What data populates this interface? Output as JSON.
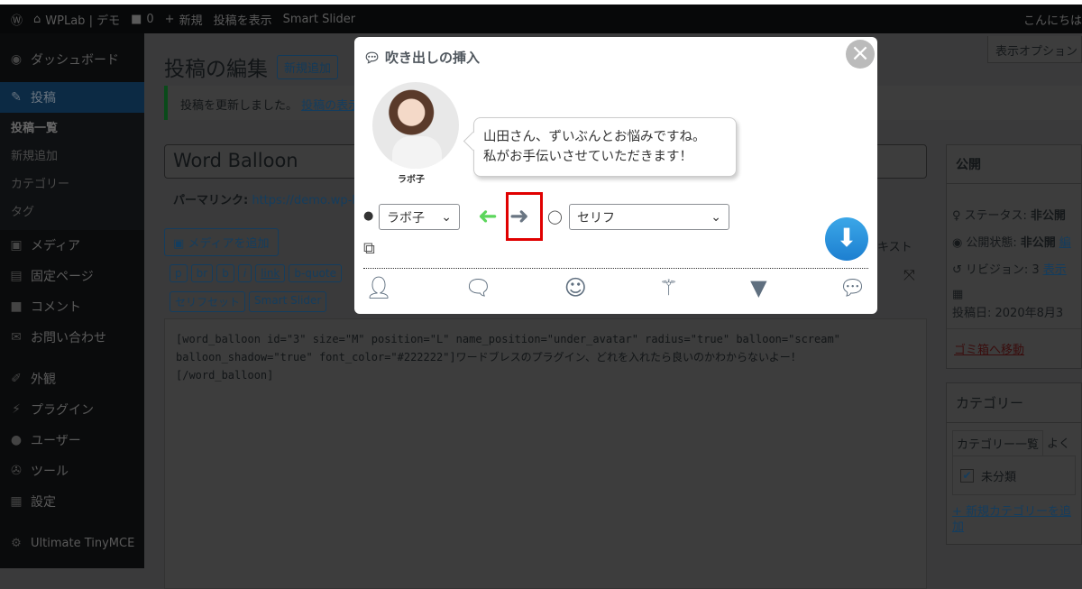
{
  "adminbar": {
    "site": "WPLab | デモ",
    "comments": "0",
    "new": "新規",
    "view": "投稿を表示",
    "slider": "Smart Slider",
    "greeting": "こんにちは"
  },
  "sidebar": {
    "dashboard": "ダッシュボード",
    "posts": "投稿",
    "sub": [
      "投稿一覧",
      "新規追加",
      "カテゴリー",
      "タグ"
    ],
    "items": [
      "メディア",
      "固定ページ",
      "コメント",
      "お問い合わせ",
      "外観",
      "プラグイン",
      "ユーザー",
      "ツール",
      "設定",
      "Ultimate TinyMCE"
    ]
  },
  "main": {
    "screen_options": "表示オプション",
    "page_title": "投稿の編集",
    "add_new": "新規追加",
    "notice": "投稿を更新しました。",
    "notice_link": "投稿の表示",
    "post_title": "Word Balloon",
    "permalink_label": "パーマリンク:",
    "permalink": "https://demo.wp-lab",
    "add_media": "メディアを追加",
    "tab_text": "テキスト",
    "quicktags": [
      "p",
      "br",
      "b",
      "i",
      "link",
      "b-quote"
    ],
    "quicktags2": [
      "セリフセット",
      "Smart Slider"
    ],
    "content": "[word_balloon id=\"3\" size=\"M\" position=\"L\" name_position=\"under_avatar\" radius=\"true\" balloon=\"scream\"\nballoon_shadow=\"true\" font_color=\"#222222\"]ワードブレスのプラグイン、どれを入れたら良いのかわからないよー！\n[/word_balloon]"
  },
  "publish": {
    "title": "公開",
    "status": "ステータス: ",
    "status_v": "非公開",
    "visibility": "公開状態: ",
    "visibility_v": "非公開",
    "visibility_link": "編",
    "revision": "リビジョン: 3",
    "revision_link": "表示",
    "date": "投稿日: 2020年8月3",
    "trash": "ゴミ箱へ移動"
  },
  "category": {
    "title": "カテゴリー",
    "tab_all": "カテゴリー一覧",
    "tab_pop": "よく",
    "item": "未分類",
    "add": "+ 新規カテゴリーを追加"
  },
  "modal": {
    "title": "吹き出しの挿入",
    "avatar_name": "ラボ子",
    "balloon_line1": "山田さん、ずいぶんとお悩みですね。",
    "balloon_line2": "私がお手伝いさせていただきます！",
    "avatar_select": "ラボ子",
    "balloon_select": "セリフ",
    "highlight_color": "#e00000",
    "arrow_left_color": "#5cd65c"
  }
}
